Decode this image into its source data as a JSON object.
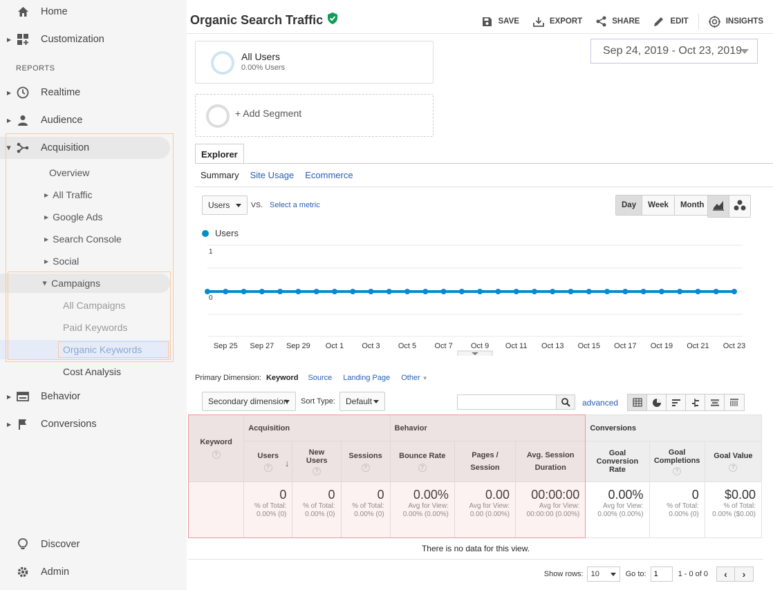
{
  "sidebar": {
    "home": "Home",
    "customization": "Customization",
    "reports_label": "REPORTS",
    "realtime": "Realtime",
    "audience": "Audience",
    "acquisition": "Acquisition",
    "overview": "Overview",
    "all_traffic": "All Traffic",
    "google_ads": "Google Ads",
    "search_console": "Search Console",
    "social": "Social",
    "campaigns": "Campaigns",
    "all_campaigns": "All Campaigns",
    "paid_keywords": "Paid Keywords",
    "organic_keywords": "Organic Keywords",
    "cost_analysis": "Cost Analysis",
    "behavior": "Behavior",
    "conversions": "Conversions",
    "discover": "Discover",
    "admin": "Admin"
  },
  "header": {
    "title": "Organic Search Traffic",
    "save": "SAVE",
    "export": "EXPORT",
    "share": "SHARE",
    "edit": "EDIT",
    "insights": "INSIGHTS"
  },
  "segments": {
    "all_users": "All Users",
    "all_users_pct": "0.00% Users",
    "add_segment": "+ Add Segment"
  },
  "date_range": "Sep 24, 2019 - Oct 23, 2019",
  "explorer": {
    "tab": "Explorer",
    "subtabs": {
      "summary": "Summary",
      "site_usage": "Site Usage",
      "ecommerce": "Ecommerce"
    }
  },
  "chart_controls": {
    "metric": "Users",
    "vs": "VS.",
    "select_metric": "Select a metric",
    "day": "Day",
    "week": "Week",
    "month": "Month"
  },
  "chart_data": {
    "type": "line",
    "series": [
      {
        "name": "Users",
        "values": [
          0,
          0,
          0,
          0,
          0,
          0,
          0,
          0,
          0,
          0,
          0,
          0,
          0,
          0,
          0,
          0,
          0,
          0,
          0,
          0,
          0,
          0,
          0,
          0,
          0,
          0,
          0,
          0,
          0,
          0
        ]
      }
    ],
    "x_ticks": [
      "Sep 25",
      "Sep 27",
      "Sep 29",
      "Oct 1",
      "Oct 3",
      "Oct 5",
      "Oct 7",
      "Oct 9",
      "Oct 11",
      "Oct 13",
      "Oct 15",
      "Oct 17",
      "Oct 19",
      "Oct 21",
      "Oct 23"
    ],
    "y_ticks": [
      "1",
      "0"
    ],
    "ylim": [
      0,
      1
    ],
    "color": "#058dc7"
  },
  "dimensions": {
    "label": "Primary Dimension:",
    "keyword": "Keyword",
    "source": "Source",
    "landing_page": "Landing Page",
    "other": "Other"
  },
  "table_controls": {
    "secondary": "Secondary dimension",
    "sort_type_label": "Sort Type:",
    "sort_type": "Default",
    "advanced": "advanced"
  },
  "table": {
    "keyword": "Keyword",
    "groups": {
      "acquisition": "Acquisition",
      "behavior": "Behavior",
      "conversions": "Conversions"
    },
    "cols": {
      "users": "Users",
      "new_users": "New Users",
      "sessions": "Sessions",
      "bounce_rate": "Bounce Rate",
      "pages_session": "Pages / Session",
      "avg_session": "Avg. Session Duration",
      "goal_conv": "Goal Conversion Rate",
      "goal_comp": "Goal Completions",
      "goal_value": "Goal Value"
    },
    "totals": {
      "users": "0",
      "users_sub": "% of Total: 0.00% (0)",
      "new_users": "0",
      "new_users_sub": "% of Total: 0.00% (0)",
      "sessions": "0",
      "sessions_sub": "% of Total: 0.00% (0)",
      "bounce_rate": "0.00%",
      "bounce_rate_sub": "Avg for View: 0.00% (0.00%)",
      "pages_session": "0.00",
      "pages_session_sub": "Avg for View: 0.00 (0.00%)",
      "avg_session": "00:00:00",
      "avg_session_sub": "Avg for View: 00:00:00 (0.00%)",
      "goal_conv": "0.00%",
      "goal_conv_sub": "Avg for View: 0.00% (0.00%)",
      "goal_comp": "0",
      "goal_comp_sub": "% of Total: 0.00% (0)",
      "goal_value": "$0.00",
      "goal_value_sub": "% of Total: 0.00% ($0.00)"
    },
    "no_data": "There is no data for this view."
  },
  "pager": {
    "show_rows_label": "Show rows:",
    "rows": "10",
    "goto_label": "Go to:",
    "goto": "1",
    "range": "1 - 0 of 0"
  }
}
